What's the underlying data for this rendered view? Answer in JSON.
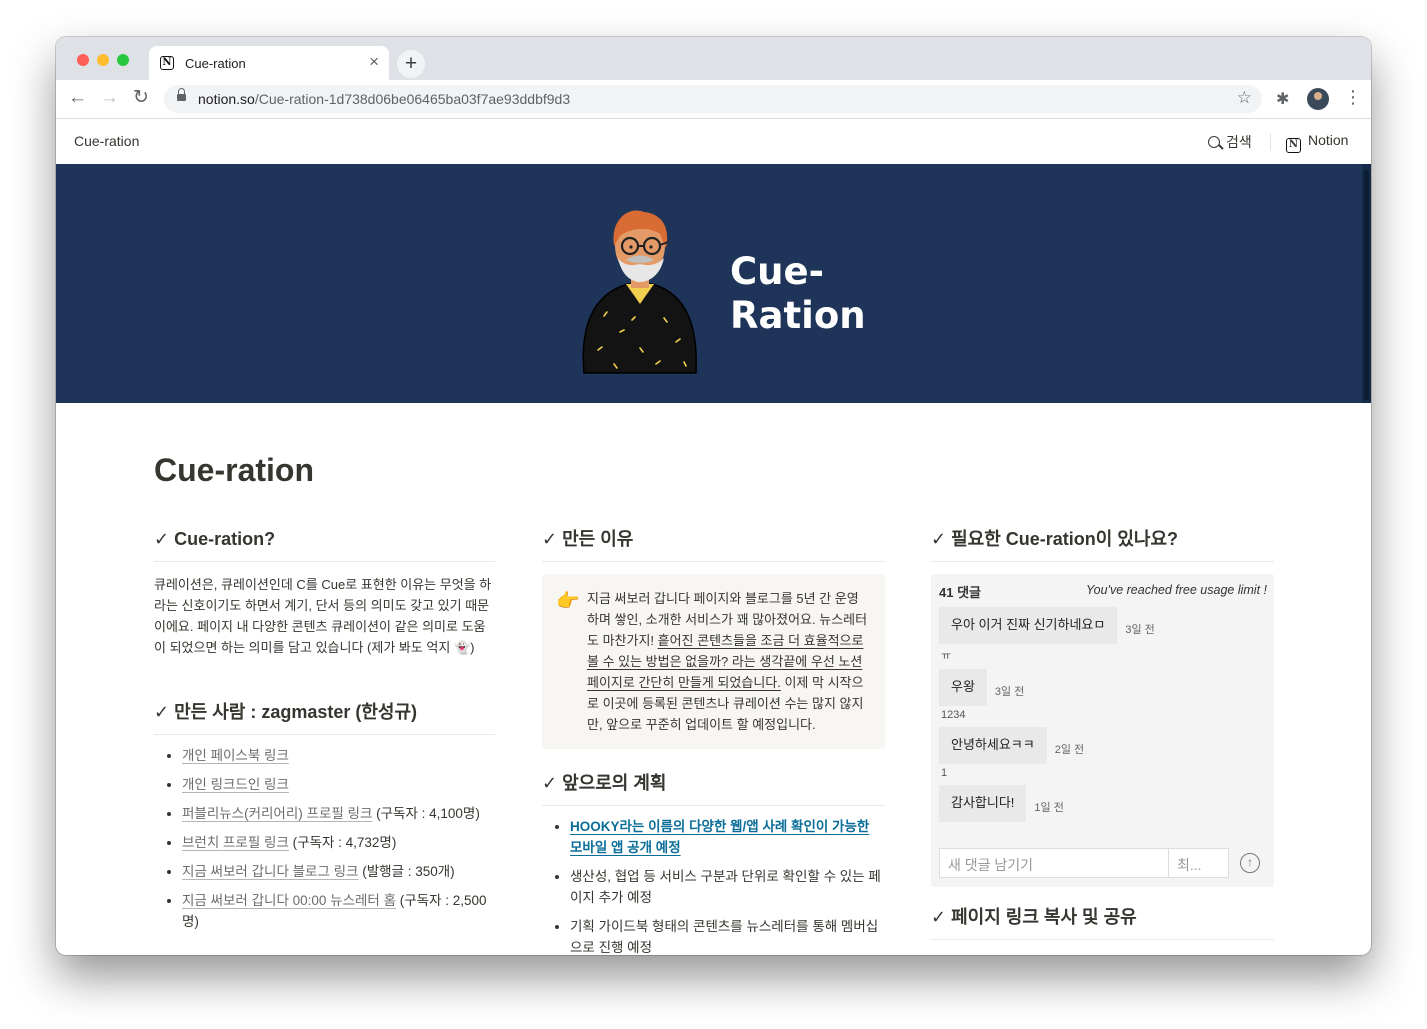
{
  "browser": {
    "tab_title": "Cue-ration",
    "tab_close": "×",
    "new_tab": "+",
    "url_host": "notion.so",
    "url_path": "/Cue-ration-1d738d06be06465ba03f7ae93ddbf9d3",
    "back": "←",
    "forward": "→",
    "reload": "↻",
    "star": "☆",
    "extensions": "✱",
    "menu": "⋮"
  },
  "topbar": {
    "brand": "Cue-ration",
    "search_label": "검색",
    "notion_label": "Notion"
  },
  "cover": {
    "line1": "Cue-",
    "line2": "Ration"
  },
  "page": {
    "title": "Cue-ration"
  },
  "col1": {
    "heading1": "✓ Cue-ration?",
    "intro": "큐레이션은, 큐레이션인데 C를 Cue로 표현한 이유는 무엇을 하라는 신호이기도 하면서 계기, 단서 등의 의미도 갖고 있기 때문이에요. 페이지 내 다양한 콘텐츠 큐레이션이 같은 의미로 도움이 되었으면 하는 의미를 담고 있습니다 (제가 봐도 억지 👻)",
    "heading2": "✓ 만든 사람 : zagmaster (한성규)",
    "links": [
      {
        "link": "개인 페이스북 링크",
        "rest": ""
      },
      {
        "link": "개인 링크드인 링크",
        "rest": ""
      },
      {
        "link": "퍼블리뉴스(커리어리) 프로필 링크",
        "rest": " (구독자 : 4,100명)"
      },
      {
        "link": "브런치 프로필 링크",
        "rest": " (구독자 : 4,732명)"
      },
      {
        "link": "지금 써보러 갑니다 블로그 링크",
        "rest": " (발행글 : 350개)"
      },
      {
        "link": "지금 써보러 갑니다 00:00 뉴스레터 홈",
        "rest": " (구독자 : 2,500명)"
      }
    ]
  },
  "col2": {
    "heading1": "✓ 만든 이유",
    "callout_icon": "👉",
    "callout_a": "지금 써보러 갑니다 페이지와 블로그를 5년 간 운영하며 쌓인, 소개한 서비스가 꽤 많아졌어요. 뉴스레터도 마찬가지! ",
    "callout_b": "흩어진 콘텐츠들을 조금 더 효율적으로 볼 수 있는 방법은 없을까? 라는 생각끝에 우선 노션 페이지로 간단히 만들게 되었습니다.",
    "callout_c": " 이제 막 시작으로 이곳에 등록된 콘텐츠나 큐레이션 수는 많지 않지만, 앞으로 꾸준히 업데이트 할 예정입니다.",
    "heading2": "✓ 앞으로의 계획",
    "plans": [
      "HOOKY라는 이름의 다양한 웹/앱 사례 확인이 가능한 모바일 앱 공개 예정",
      "생산성, 협업 등 서비스 구분과 단위로 확인할 수 있는 페이지 추가 예정",
      "기획 가이드북 형태의 콘텐츠를 뉴스레터를 통해 멤버십으로 진행 예정"
    ]
  },
  "col3": {
    "heading1": "✓ 필요한 Cue-ration이 있나요?",
    "comment_count": "41 댓글",
    "limit_notice": "You've reached free usage limit !",
    "comments": [
      {
        "text": "우아 이거 진짜 신기하네요ㅁ",
        "time": "3일 전",
        "meta": "ㅠ"
      },
      {
        "text": "우왕",
        "time": "3일 전",
        "meta": "1234"
      },
      {
        "text": "안녕하세요ㅋㅋ",
        "time": "2일 전",
        "meta": "1"
      },
      {
        "text": "감사합니다!",
        "time": "1일 전",
        "meta": ""
      }
    ],
    "input_placeholder": "새 댓글 남기기",
    "name_placeholder": "최...",
    "send": "↑",
    "heading2": "✓ 페이지 링크 복사 및 공유"
  }
}
